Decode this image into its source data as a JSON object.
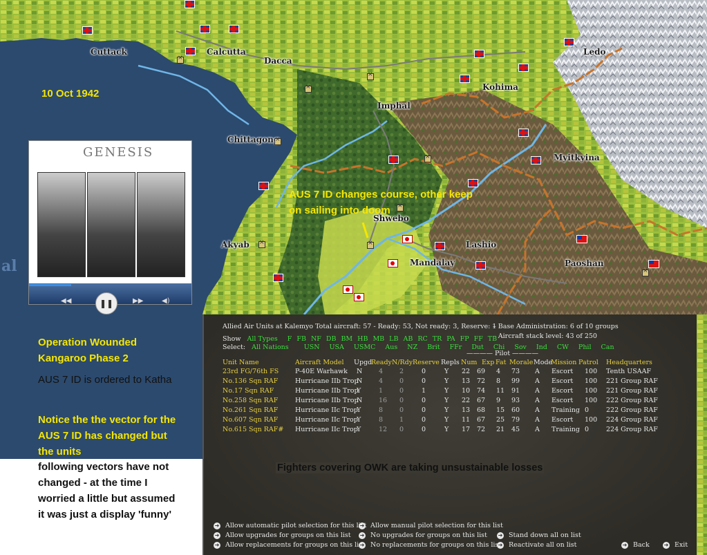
{
  "map": {
    "cities": {
      "cuttack": "Cuttack",
      "calcutta": "Calcutta",
      "dacca": "Dacca",
      "ledo": "Ledo",
      "kohima": "Kohima",
      "imphal": "Imphal",
      "chittagong": "Chittagong",
      "myitkyina": "Myitkyina",
      "shwebo": "Shwebo",
      "lashio": "Lashio",
      "akyab": "Akyab",
      "mandalay": "Mandalay",
      "paoshan": "Paoshan"
    },
    "date": "10 Oct 1942",
    "map_note": "AUS 7 ID changes course, other keep on sailing into doom",
    "edge_text": "al"
  },
  "annotations": {
    "operation_title": "Operation Wounded Kangaroo Phase 2",
    "ordered": "AUS 7 ID is ordered to Katha",
    "notice_yellow": "Notice the the vector for the AUS 7 ID has changed but the units",
    "notice_black": "following vectors have not changed - at the time I worried a little but assumed it was just a display 'funny'"
  },
  "video": {
    "album_title": "GENESIS",
    "controls": {
      "rewind": "◀◀",
      "play": "❚❚",
      "forward": "▶▶",
      "volume": "◀)"
    },
    "progress": 0.26
  },
  "panel": {
    "title": "Allied Air Units at Kalemyo   Total aircraft: 57 - Ready: 53, Not ready: 3, Reserve: 1",
    "base_admin": "– Base Administration: 6 of 10 groups",
    "stack_level": "– Aircraft stack level: 43 of 250",
    "show_label": "Show",
    "show_filters": [
      "All Types",
      "F",
      "FB",
      "NF",
      "DB",
      "BM",
      "HB",
      "MB",
      "LB",
      "AB",
      "RC",
      "TR",
      "PA",
      "FP",
      "FF",
      "TB"
    ],
    "select_label": "Select:",
    "select_filters": [
      "All Nations",
      "USN",
      "USA",
      "USMC",
      "Aus",
      "NZ",
      "Brit",
      "FFr",
      "Dut",
      "Chi",
      "Sov",
      "Ind",
      "CW",
      "Phil",
      "Can"
    ],
    "pilot_label": "———— Pilot ————",
    "columns": {
      "unit": "Unit Name",
      "aircraft": "Aircraft Model",
      "upgd": "Upgd",
      "ready": "Ready",
      "nrdy": "N/Rdy",
      "reserve": "Reserve",
      "repls": "Repls",
      "num": "Num",
      "exp": "Exp",
      "fat": "Fat",
      "morale": "Morale",
      "mode": "Mode",
      "mission": "Mission",
      "patrol": "Patrol",
      "hq": "Headquarters"
    },
    "rows": [
      {
        "unit": "23rd FG/76th FS",
        "aircraft": "P-40E Warhawk",
        "upgd": "N",
        "ready": "4",
        "nrdy": "2",
        "reserve": "0",
        "repls": "Y",
        "num": "22",
        "exp": "69",
        "fat": "4",
        "morale": "73",
        "mode": "A",
        "mission": "Escort",
        "patrol": "100",
        "hq": "Tenth USAAF"
      },
      {
        "unit": "No.136 Sqn RAF",
        "aircraft": "Hurricane IIb Trop",
        "upgd": "N",
        "ready": "4",
        "nrdy": "0",
        "reserve": "0",
        "repls": "Y",
        "num": "13",
        "exp": "72",
        "fat": "8",
        "morale": "99",
        "mode": "A",
        "mission": "Escort",
        "patrol": "100",
        "hq": "221 Group RAF"
      },
      {
        "unit": "No.17 Sqn RAF",
        "aircraft": "Hurricane IIb Trop",
        "upgd": "Y",
        "ready": "1",
        "nrdy": "0",
        "reserve": "1",
        "repls": "Y",
        "num": "10",
        "exp": "74",
        "fat": "11",
        "morale": "91",
        "mode": "A",
        "mission": "Escort",
        "patrol": "100",
        "hq": "221 Group RAF"
      },
      {
        "unit": "No.258 Sqn RAF",
        "aircraft": "Hurricane IIb Trop",
        "upgd": "N",
        "ready": "16",
        "nrdy": "0",
        "reserve": "0",
        "repls": "Y",
        "num": "22",
        "exp": "67",
        "fat": "9",
        "morale": "93",
        "mode": "A",
        "mission": "Escort",
        "patrol": "100",
        "hq": "222 Group RAF"
      },
      {
        "unit": "No.261 Sqn RAF",
        "aircraft": "Hurricane IIc Trop",
        "upgd": "Y",
        "ready": "8",
        "nrdy": "0",
        "reserve": "0",
        "repls": "Y",
        "num": "13",
        "exp": "68",
        "fat": "15",
        "morale": "60",
        "mode": "A",
        "mission": "Training",
        "patrol": "0",
        "hq": "222 Group RAF"
      },
      {
        "unit": "No.607 Sqn RAF",
        "aircraft": "Hurricane IIc Trop",
        "upgd": "Y",
        "ready": "8",
        "nrdy": "1",
        "reserve": "0",
        "repls": "Y",
        "num": "11",
        "exp": "67",
        "fat": "25",
        "morale": "79",
        "mode": "A",
        "mission": "Escort",
        "patrol": "100",
        "hq": "224 Group RAF"
      },
      {
        "unit": "No.615 Sqn RAF#",
        "aircraft": "Hurricane IIc Trop",
        "upgd": "Y",
        "ready": "12",
        "nrdy": "0",
        "reserve": "0",
        "repls": "Y",
        "num": "17",
        "exp": "72",
        "fat": "21",
        "morale": "45",
        "mode": "A",
        "mission": "Training",
        "patrol": "0",
        "hq": "224 Group RAF"
      }
    ],
    "losses_note": "Fighters covering OWK are taking unsustainable losses",
    "options": {
      "auto_pilot": "Allow automatic pilot selection for this list",
      "manual_pilot": "Allow manual pilot selection for this list",
      "allow_upgrades": "Allow upgrades for groups on this list",
      "no_upgrades": "No upgrades for groups on this list",
      "stand_down": "Stand down all on list",
      "allow_repl": "Allow replacements for groups on this list",
      "no_repl": "No replacements for groups on this list",
      "reactivate": "Reactivate all on list",
      "back": "Back",
      "exit": "Exit"
    }
  },
  "colors": {
    "annotation_yellow": "#f5e600",
    "unit_name": "#e8d040",
    "filter_green": "#39e03c",
    "panel_bg": "#34322c",
    "sea": "#2c4a6e",
    "river": "#6fb6e8",
    "border": "#c8742a"
  }
}
